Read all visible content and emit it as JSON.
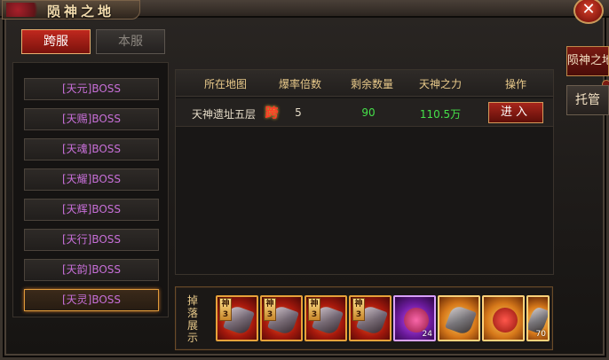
{
  "window": {
    "title": "陨神之地",
    "close_label": "✕"
  },
  "tabs": [
    {
      "label": "跨服",
      "active": true
    },
    {
      "label": "本服",
      "active": false
    }
  ],
  "side_tabs": [
    {
      "label": "陨神之地"
    },
    {
      "label": "托管"
    }
  ],
  "boss_list": [
    {
      "label": "[天元]BOSS"
    },
    {
      "label": "[天赐]BOSS"
    },
    {
      "label": "[天魂]BOSS"
    },
    {
      "label": "[天耀]BOSS"
    },
    {
      "label": "[天辉]BOSS"
    },
    {
      "label": "[天行]BOSS"
    },
    {
      "label": "[天韵]BOSS"
    },
    {
      "label": "[天灵]BOSS",
      "active": true
    }
  ],
  "table": {
    "headers": [
      "所在地图",
      "爆率倍数",
      "剩余数量",
      "天神之力",
      "操作"
    ],
    "rows": [
      {
        "map": "天神遗址五层",
        "badge": "跨",
        "rate": "5",
        "remaining": "90",
        "power": "110.5万",
        "action": "进入"
      }
    ]
  },
  "drops": {
    "label": "掉落展示",
    "items": [
      {
        "icon": "sword-icon",
        "badge": "神3",
        "style": "red"
      },
      {
        "icon": "armor-icon",
        "badge": "神3",
        "style": "red"
      },
      {
        "icon": "helmet-icon",
        "badge": "神3",
        "style": "red"
      },
      {
        "icon": "weapon-icon",
        "badge": "神3",
        "style": "red"
      },
      {
        "icon": "orb-icon",
        "badge": "",
        "count": "24",
        "style": "purple"
      },
      {
        "icon": "stone-icon",
        "badge": "",
        "style": "gold"
      },
      {
        "icon": "gem-icon",
        "badge": "",
        "style": "gold"
      },
      {
        "icon": "scroll-icon",
        "badge": "",
        "count": "70",
        "style": "gold"
      }
    ]
  },
  "colors": {
    "boss_text": "#c76fd8",
    "value_green": "#46e04a",
    "header_gold": "#e8c98a",
    "active_tab_red": "#c0281e"
  }
}
